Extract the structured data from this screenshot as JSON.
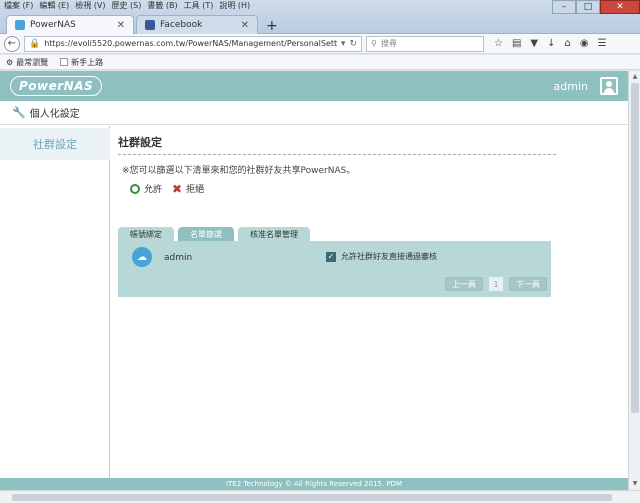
{
  "browser": {
    "menu": [
      "檔案 (F)",
      "編輯 (E)",
      "檢視 (V)",
      "歷史 (S)",
      "書籤 (B)",
      "工具 (T)",
      "說明 (H)"
    ],
    "tabs": [
      {
        "label": "PowerNAS",
        "active": true
      },
      {
        "label": "Facebook",
        "active": false
      }
    ],
    "url": "https://evoli5520.powernas.com.tw/PowerNAS/Management/PersonalSetting/PersonalSo",
    "search_placeholder": "搜尋",
    "bookmarks": [
      "最常瀏覽",
      "新手上路"
    ]
  },
  "app": {
    "logo": "PowerNAS",
    "user": "admin",
    "breadcrumb": "個人化設定",
    "sidebar": [
      {
        "label": "社群設定"
      }
    ],
    "section_title": "社群設定",
    "description": "※您可以篩選以下清單來和您的社群好友共享PowerNAS。",
    "choices": {
      "allow": "允許",
      "deny": "拒絕"
    },
    "tabs": [
      {
        "label": "帳號綁定",
        "active": false
      },
      {
        "label": "名單篩選",
        "active": true
      },
      {
        "label": "核准名單管理",
        "active": false
      }
    ],
    "row": {
      "name": "admin",
      "checkbox_label": "允許社群好友直接通過審核",
      "checked": true
    },
    "pager": {
      "prev": "上一頁",
      "page": "1",
      "next": "下一頁"
    },
    "footer": "ITE2 Technology © All Rights Reserved 2015. PDM"
  },
  "colors": {
    "accent": "#8fc0c0",
    "panel": "#b8d8d8",
    "sidebar_text": "#6fa7b5"
  }
}
